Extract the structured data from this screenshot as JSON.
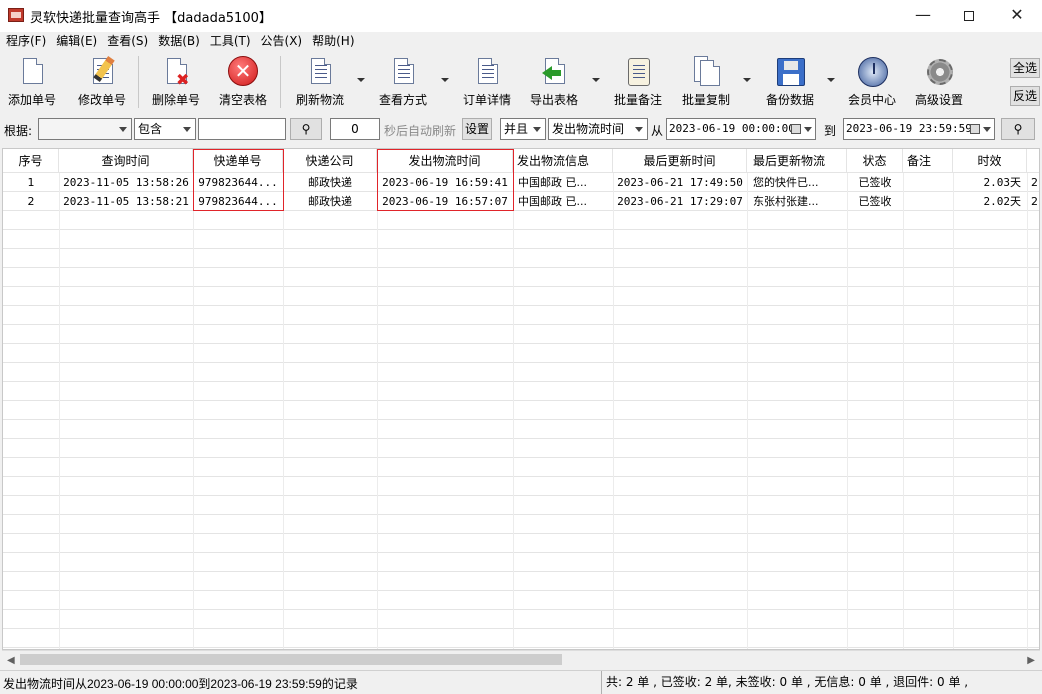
{
  "window": {
    "title": "灵软快递批量查询高手 【dadada5100】",
    "minimize_icon": "minimize-icon",
    "maximize_icon": "maximize-icon",
    "close_icon": "close-icon"
  },
  "menu": [
    "程序(F)",
    "编辑(E)",
    "查看(S)",
    "数据(B)",
    "工具(T)",
    "公告(X)",
    "帮助(H)"
  ],
  "toolbar": {
    "add": "添加单号",
    "edit": "修改单号",
    "delete": "删除单号",
    "clear": "清空表格",
    "refresh": "刷新物流",
    "view_mode": "查看方式",
    "order_detail": "订单详情",
    "export": "导出表格",
    "batch_note": "批量备注",
    "batch_copy": "批量复制",
    "backup": "备份数据",
    "member": "会员中心",
    "advanced": "高级设置",
    "select_all": "全选",
    "invert": "反选"
  },
  "filter": {
    "by_label": "根据:",
    "by_value": "",
    "match_mode": "包含",
    "keyword": "",
    "refresh_seconds": "0",
    "auto_refresh_label": "秒后自动刷新",
    "set_button": "设置",
    "logic": "并且",
    "time_field": "发出物流时间",
    "from_label": "从",
    "from_value": "2023-06-19 00:00:00",
    "to_label": "到",
    "to_value": "2023-06-19 23:59:59"
  },
  "table": {
    "columns": [
      "序号",
      "查询时间",
      "快递单号",
      "快递公司",
      "发出物流时间",
      "发出物流信息",
      "最后更新时间",
      "最后更新物流",
      "状态",
      "备注",
      "时效"
    ],
    "rows": [
      [
        "1",
        "2023-11-05 13:58:26",
        "979823644...",
        "邮政快递",
        "2023-06-19 16:59:41",
        "中国邮政 已...",
        "2023-06-21 17:49:50",
        "您的快件已...",
        "已签收",
        "",
        "2.03天",
        "2"
      ],
      [
        "2",
        "2023-11-05 13:58:21",
        "979823644...",
        "邮政快递",
        "2023-06-19 16:57:07",
        "中国邮政 已...",
        "2023-06-21 17:29:07",
        "东张村张建...",
        "已签收",
        "",
        "2.02天",
        "2"
      ]
    ]
  },
  "status": {
    "left": "发出物流时间从2023-06-19 00:00:00到2023-06-19 23:59:59的记录",
    "right": "共: 2 单 , 已签收: 2 单, 未签收: 0 单 , 无信息: 0 单 , 退回件: 0 单 ,"
  },
  "colors": {
    "highlight_box": "#e0242a",
    "grid_line": "#e4e4e4"
  }
}
